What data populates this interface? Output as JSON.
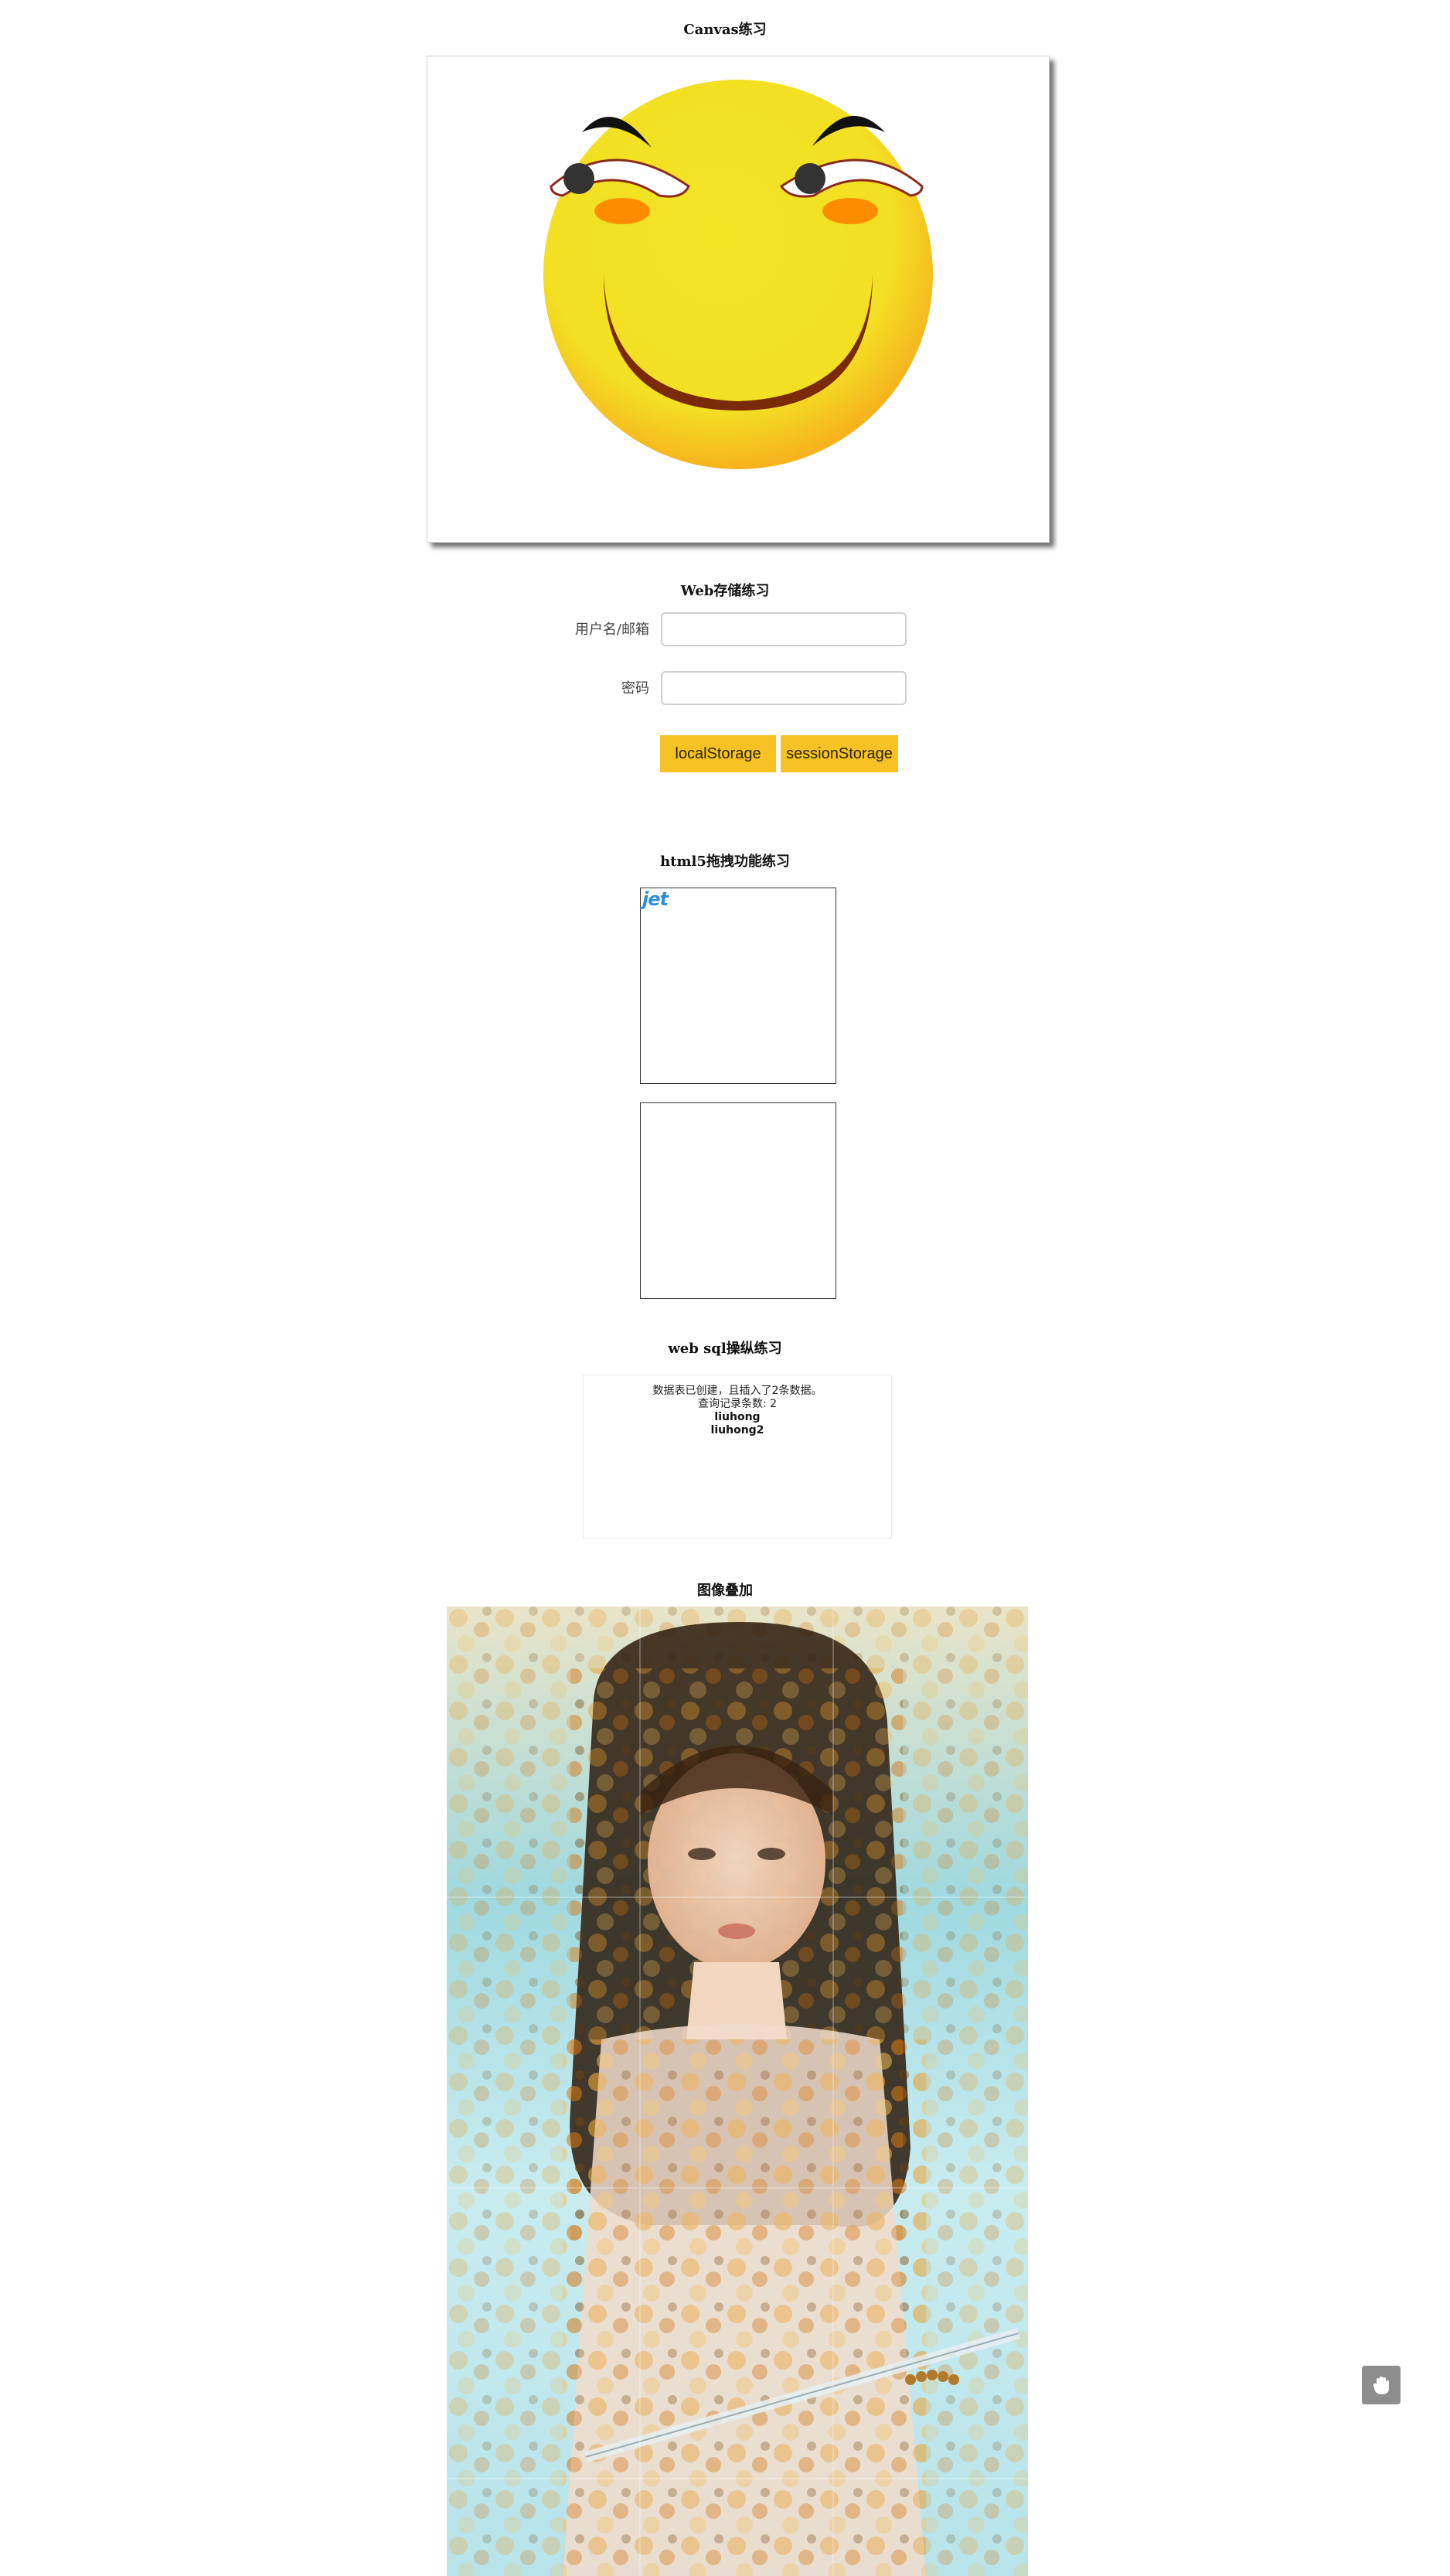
{
  "canvas_section": {
    "title": "Canvas练习"
  },
  "web_storage": {
    "title": "Web存储练习",
    "username_label": "用户名/邮箱",
    "username_value": "",
    "password_label": "密码",
    "password_value": "",
    "buttons": {
      "local": "localStorage",
      "session": "sessionStorage"
    }
  },
  "drag_section": {
    "title": "html5拖拽功能练习",
    "draggable_logo_text": "jet"
  },
  "web_sql": {
    "title": "web sql操纵练习",
    "status_line": "数据表已创建，且插入了2条数据。",
    "count_line": "查询记录条数: 2",
    "records": [
      "liuhong",
      "liuhong2"
    ]
  },
  "image_overlay": {
    "title": "图像叠加"
  },
  "colors": {
    "button_bg": "#f7c224",
    "face_yellow": "#f2e524",
    "face_edge": "#f6b31e",
    "mouth": "#7a2a06",
    "cheek": "#ff8c00"
  },
  "icons": {
    "floating_button": "hand-icon"
  }
}
